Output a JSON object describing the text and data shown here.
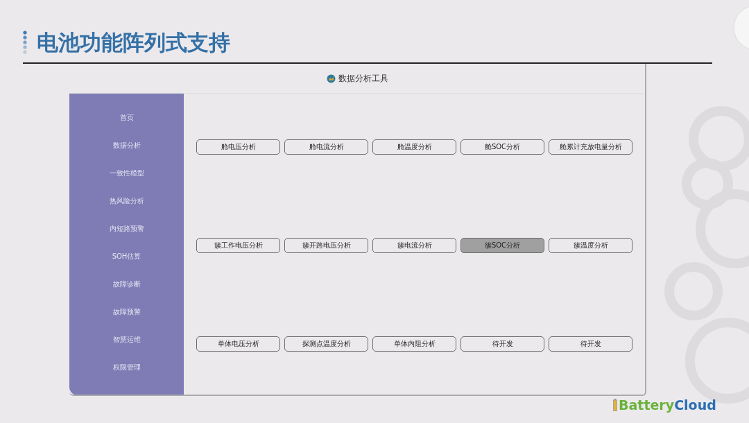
{
  "slide_title": "电池功能阵列式支持",
  "window": {
    "title": "数据分析工具"
  },
  "sidebar": {
    "items": [
      {
        "label": "首页"
      },
      {
        "label": "数据分析"
      },
      {
        "label": "一致性模型"
      },
      {
        "label": "热风险分析"
      },
      {
        "label": "内短路预警"
      },
      {
        "label": "SOH估算"
      },
      {
        "label": "故障诊断"
      },
      {
        "label": "故障预警"
      },
      {
        "label": "智慧运维"
      },
      {
        "label": "权限管理"
      }
    ]
  },
  "button_rows": [
    [
      {
        "label": "舱电压分析",
        "selected": false
      },
      {
        "label": "舱电流分析",
        "selected": false
      },
      {
        "label": "舱温度分析",
        "selected": false
      },
      {
        "label": "舱SOC分析",
        "selected": false
      },
      {
        "label": "舱累计充放电量分析",
        "selected": false
      }
    ],
    [
      {
        "label": "簇工作电压分析",
        "selected": false
      },
      {
        "label": "簇开路电压分析",
        "selected": false
      },
      {
        "label": "簇电流分析",
        "selected": false
      },
      {
        "label": "簇SOC分析",
        "selected": true
      },
      {
        "label": "簇温度分析",
        "selected": false
      }
    ],
    [
      {
        "label": "单体电压分析",
        "selected": false
      },
      {
        "label": "探测点温度分析",
        "selected": false
      },
      {
        "label": "单体内阻分析",
        "selected": false
      },
      {
        "label": "待开发",
        "selected": false
      },
      {
        "label": "待开发",
        "selected": false
      }
    ]
  ],
  "logo": {
    "first": "Battery",
    "second": "Cloud"
  }
}
